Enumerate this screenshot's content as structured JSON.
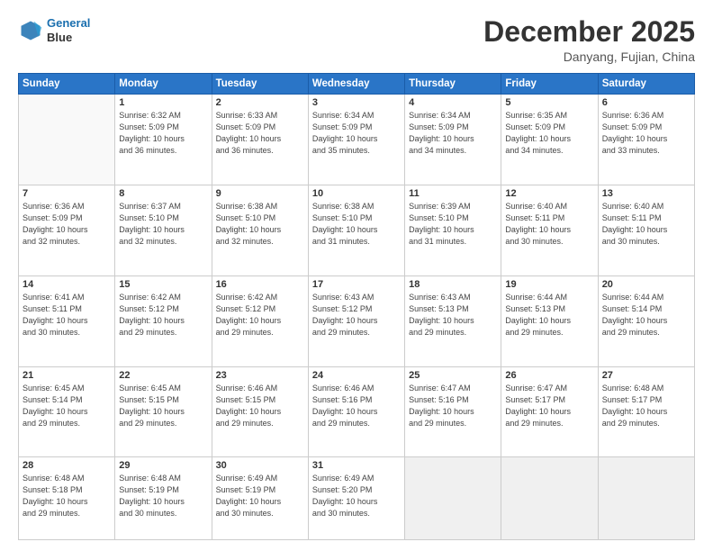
{
  "logo": {
    "line1": "General",
    "line2": "Blue"
  },
  "title": "December 2025",
  "location": "Danyang, Fujian, China",
  "weekdays": [
    "Sunday",
    "Monday",
    "Tuesday",
    "Wednesday",
    "Thursday",
    "Friday",
    "Saturday"
  ],
  "weeks": [
    [
      {
        "day": "",
        "info": ""
      },
      {
        "day": "1",
        "info": "Sunrise: 6:32 AM\nSunset: 5:09 PM\nDaylight: 10 hours\nand 36 minutes."
      },
      {
        "day": "2",
        "info": "Sunrise: 6:33 AM\nSunset: 5:09 PM\nDaylight: 10 hours\nand 36 minutes."
      },
      {
        "day": "3",
        "info": "Sunrise: 6:34 AM\nSunset: 5:09 PM\nDaylight: 10 hours\nand 35 minutes."
      },
      {
        "day": "4",
        "info": "Sunrise: 6:34 AM\nSunset: 5:09 PM\nDaylight: 10 hours\nand 34 minutes."
      },
      {
        "day": "5",
        "info": "Sunrise: 6:35 AM\nSunset: 5:09 PM\nDaylight: 10 hours\nand 34 minutes."
      },
      {
        "day": "6",
        "info": "Sunrise: 6:36 AM\nSunset: 5:09 PM\nDaylight: 10 hours\nand 33 minutes."
      }
    ],
    [
      {
        "day": "7",
        "info": "Sunrise: 6:36 AM\nSunset: 5:09 PM\nDaylight: 10 hours\nand 32 minutes."
      },
      {
        "day": "8",
        "info": "Sunrise: 6:37 AM\nSunset: 5:10 PM\nDaylight: 10 hours\nand 32 minutes."
      },
      {
        "day": "9",
        "info": "Sunrise: 6:38 AM\nSunset: 5:10 PM\nDaylight: 10 hours\nand 32 minutes."
      },
      {
        "day": "10",
        "info": "Sunrise: 6:38 AM\nSunset: 5:10 PM\nDaylight: 10 hours\nand 31 minutes."
      },
      {
        "day": "11",
        "info": "Sunrise: 6:39 AM\nSunset: 5:10 PM\nDaylight: 10 hours\nand 31 minutes."
      },
      {
        "day": "12",
        "info": "Sunrise: 6:40 AM\nSunset: 5:11 PM\nDaylight: 10 hours\nand 30 minutes."
      },
      {
        "day": "13",
        "info": "Sunrise: 6:40 AM\nSunset: 5:11 PM\nDaylight: 10 hours\nand 30 minutes."
      }
    ],
    [
      {
        "day": "14",
        "info": "Sunrise: 6:41 AM\nSunset: 5:11 PM\nDaylight: 10 hours\nand 30 minutes."
      },
      {
        "day": "15",
        "info": "Sunrise: 6:42 AM\nSunset: 5:12 PM\nDaylight: 10 hours\nand 29 minutes."
      },
      {
        "day": "16",
        "info": "Sunrise: 6:42 AM\nSunset: 5:12 PM\nDaylight: 10 hours\nand 29 minutes."
      },
      {
        "day": "17",
        "info": "Sunrise: 6:43 AM\nSunset: 5:12 PM\nDaylight: 10 hours\nand 29 minutes."
      },
      {
        "day": "18",
        "info": "Sunrise: 6:43 AM\nSunset: 5:13 PM\nDaylight: 10 hours\nand 29 minutes."
      },
      {
        "day": "19",
        "info": "Sunrise: 6:44 AM\nSunset: 5:13 PM\nDaylight: 10 hours\nand 29 minutes."
      },
      {
        "day": "20",
        "info": "Sunrise: 6:44 AM\nSunset: 5:14 PM\nDaylight: 10 hours\nand 29 minutes."
      }
    ],
    [
      {
        "day": "21",
        "info": "Sunrise: 6:45 AM\nSunset: 5:14 PM\nDaylight: 10 hours\nand 29 minutes."
      },
      {
        "day": "22",
        "info": "Sunrise: 6:45 AM\nSunset: 5:15 PM\nDaylight: 10 hours\nand 29 minutes."
      },
      {
        "day": "23",
        "info": "Sunrise: 6:46 AM\nSunset: 5:15 PM\nDaylight: 10 hours\nand 29 minutes."
      },
      {
        "day": "24",
        "info": "Sunrise: 6:46 AM\nSunset: 5:16 PM\nDaylight: 10 hours\nand 29 minutes."
      },
      {
        "day": "25",
        "info": "Sunrise: 6:47 AM\nSunset: 5:16 PM\nDaylight: 10 hours\nand 29 minutes."
      },
      {
        "day": "26",
        "info": "Sunrise: 6:47 AM\nSunset: 5:17 PM\nDaylight: 10 hours\nand 29 minutes."
      },
      {
        "day": "27",
        "info": "Sunrise: 6:48 AM\nSunset: 5:17 PM\nDaylight: 10 hours\nand 29 minutes."
      }
    ],
    [
      {
        "day": "28",
        "info": "Sunrise: 6:48 AM\nSunset: 5:18 PM\nDaylight: 10 hours\nand 29 minutes."
      },
      {
        "day": "29",
        "info": "Sunrise: 6:48 AM\nSunset: 5:19 PM\nDaylight: 10 hours\nand 30 minutes."
      },
      {
        "day": "30",
        "info": "Sunrise: 6:49 AM\nSunset: 5:19 PM\nDaylight: 10 hours\nand 30 minutes."
      },
      {
        "day": "31",
        "info": "Sunrise: 6:49 AM\nSunset: 5:20 PM\nDaylight: 10 hours\nand 30 minutes."
      },
      {
        "day": "",
        "info": ""
      },
      {
        "day": "",
        "info": ""
      },
      {
        "day": "",
        "info": ""
      }
    ]
  ]
}
